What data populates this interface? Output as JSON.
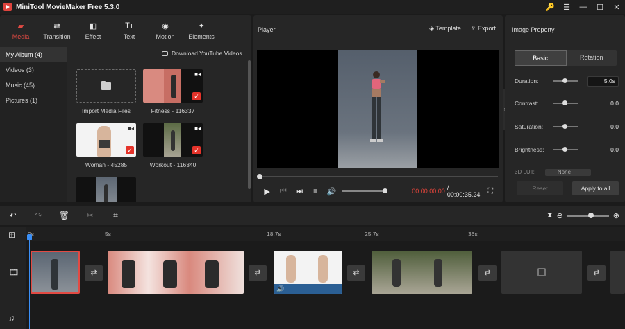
{
  "app": {
    "title": "MiniTool MovieMaker Free 5.3.0",
    "window_controls": [
      "key-icon",
      "menu-icon",
      "minimize-icon",
      "maximize-icon",
      "close-icon"
    ]
  },
  "toolbar": {
    "items": [
      {
        "label": "Media",
        "icon": "folder-icon",
        "active": true
      },
      {
        "label": "Transition",
        "icon": "transition-icon"
      },
      {
        "label": "Effect",
        "icon": "effect-icon"
      },
      {
        "label": "Text",
        "icon": "text-icon"
      },
      {
        "label": "Motion",
        "icon": "motion-icon"
      },
      {
        "label": "Elements",
        "icon": "elements-icon"
      }
    ]
  },
  "albums": [
    {
      "label": "My Album (4)",
      "active": true
    },
    {
      "label": "Videos (3)"
    },
    {
      "label": "Music (45)"
    },
    {
      "label": "Pictures (1)"
    }
  ],
  "media": {
    "download_label": "Download YouTube Videos",
    "items": [
      {
        "label": "Import Media Files"
      },
      {
        "label": "Fitness - 116337"
      },
      {
        "label": "Woman - 45285"
      },
      {
        "label": "Workout - 116340"
      }
    ]
  },
  "player": {
    "title": "Player",
    "template_label": "Template",
    "export_label": "Export",
    "time_current": "00:00:00.00",
    "time_total": "/ 00:00:35.24",
    "progress": 0,
    "volume": 1.0
  },
  "property": {
    "title": "Image Property",
    "tabs": [
      "Basic",
      "Rotation"
    ],
    "duration_label": "Duration:",
    "duration_value": "5.0s",
    "contrast_label": "Contrast:",
    "contrast_value": "0.0",
    "saturation_label": "Saturation:",
    "saturation_value": "0.0",
    "brightness_label": "Brightness:",
    "brightness_value": "0.0",
    "lut_label": "3D LUT:",
    "lut_value": "None",
    "reset_label": "Reset",
    "apply_label": "Apply to all"
  },
  "timeline": {
    "ruler": [
      "0s",
      "5s",
      "18.7s",
      "25.7s",
      "36s"
    ],
    "colors": {
      "playhead": "#3a8ff7",
      "accent": "#e24a43"
    }
  }
}
